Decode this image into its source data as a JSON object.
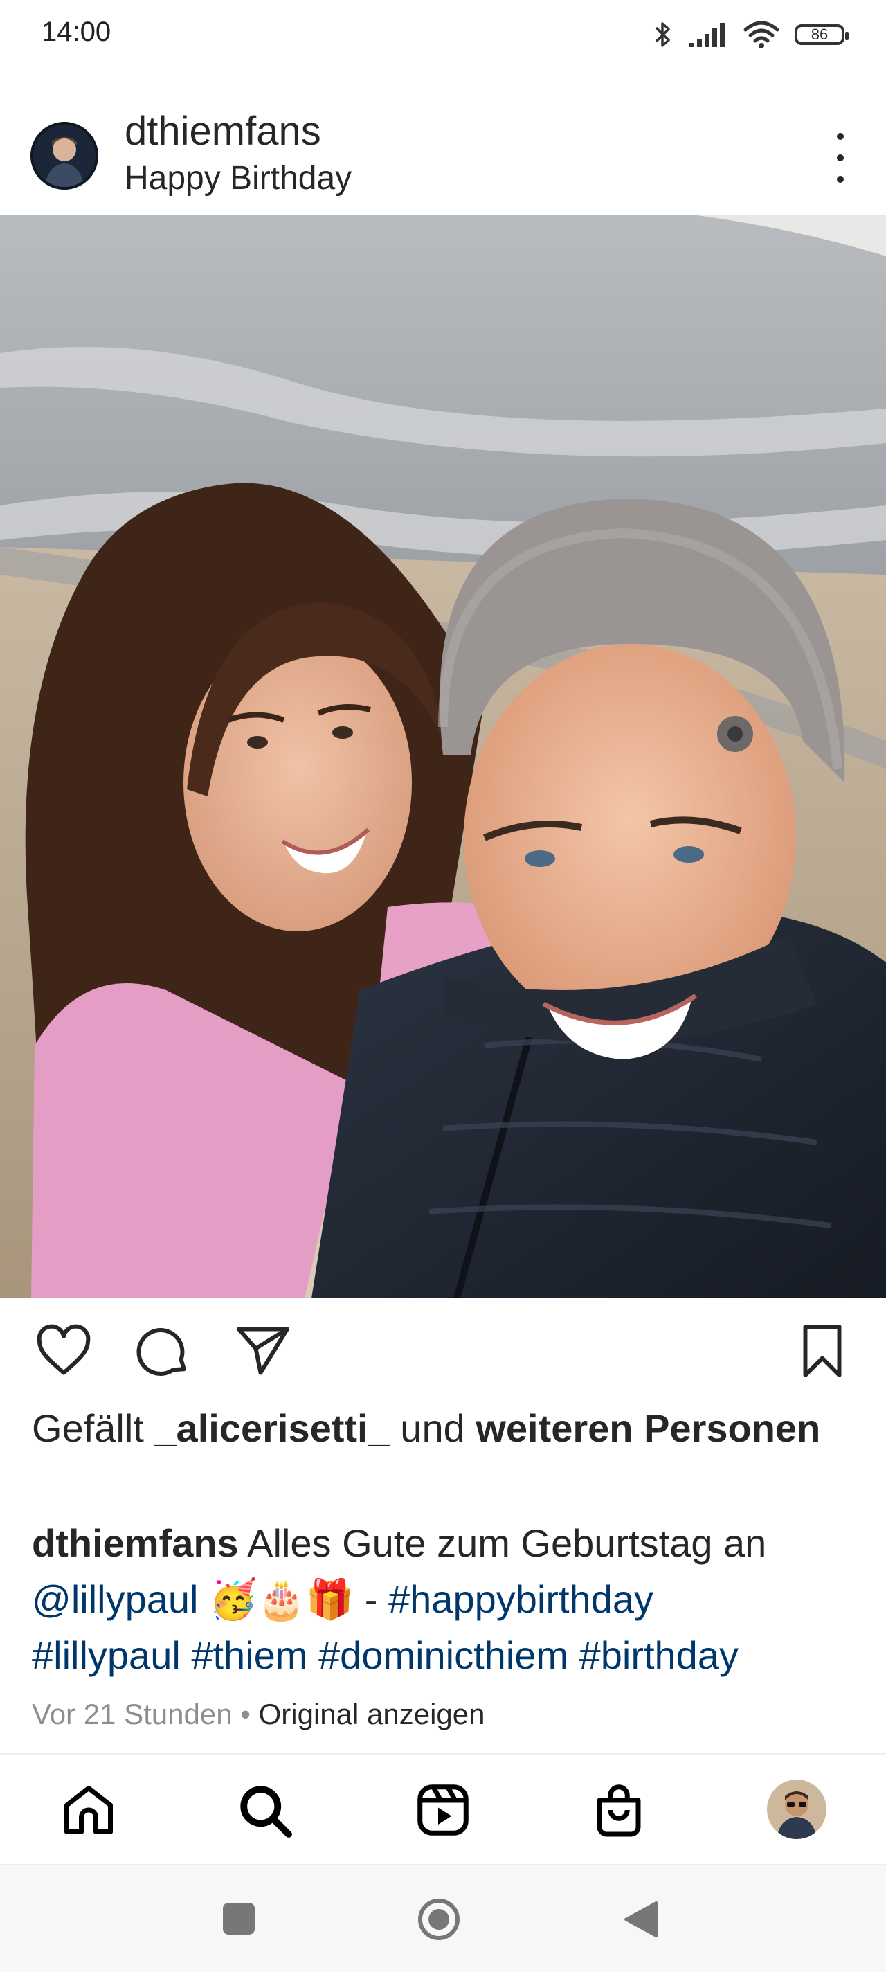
{
  "status_bar": {
    "time": "14:00",
    "battery": "86",
    "icons": [
      "bluetooth-icon",
      "signal-icon",
      "wifi-icon",
      "battery-icon"
    ]
  },
  "post": {
    "username": "dthiemfans",
    "location": "Happy Birthday",
    "likes": {
      "prefix": "Gefällt ",
      "user": "_alicerisetti_",
      "middle": " und ",
      "rest": "weiteren Personen"
    },
    "caption": {
      "user": "dthiemfans",
      "text": " Alles Gute zum Geburtstag an ",
      "mention": "@lillypaul",
      "emojis": " 🥳🎂🎁 ",
      "dash": "- ",
      "tag1": "#happybirthday",
      "tags": "#lillypaul #thiem #dominicthiem #birthday"
    },
    "meta": {
      "time": "Vor 21 Stunden",
      "separator": " • ",
      "translate": "Original anzeigen"
    }
  },
  "nav": [
    "home-icon",
    "search-icon",
    "reels-icon",
    "shop-icon",
    "profile-avatar"
  ],
  "system_nav": [
    "recents-button",
    "home-button",
    "back-button"
  ],
  "colors": {
    "link": "#00376b",
    "text": "#262626",
    "muted": "#8e8e8e"
  }
}
